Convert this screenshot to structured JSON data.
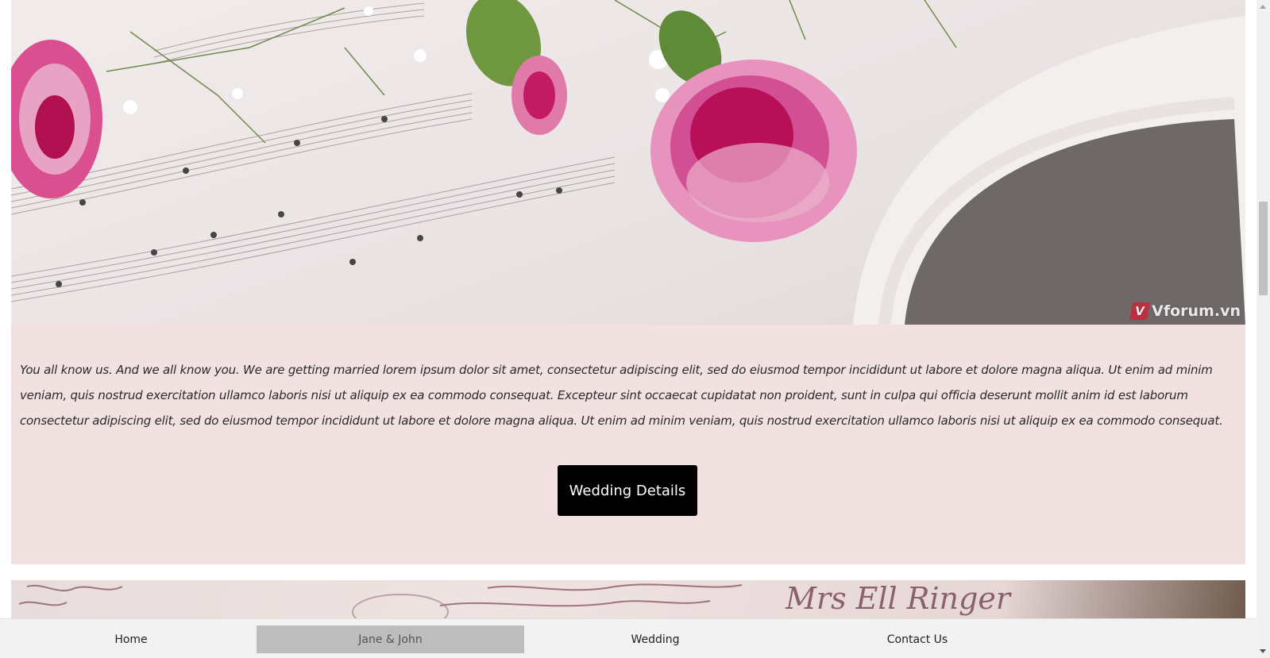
{
  "hero": {
    "image_name": "flowers-on-sheet-music",
    "watermark_logo": "V",
    "watermark_text": "Vforum.vn"
  },
  "intro": {
    "text": "You all know us. And we all know you. We are getting married lorem ipsum dolor sit amet, consectetur adipiscing elit, sed do eiusmod tempor incididunt ut labore et dolore magna aliqua. Ut enim ad minim veniam, quis nostrud exercitation ullamco laboris nisi ut aliquip ex ea commodo consequat. Excepteur sint occaecat cupidatat non proident, sunt in culpa qui officia deserunt mollit anim id est laborum consectetur adipiscing elit, sed do eiusmod tempor incididunt ut labore et dolore magna aliqua. Ut enim ad minim veniam, quis nostrud exercitation ullamco laboris nisi ut aliquip ex ea commodo consequat.",
    "button_label": "Wedding Details",
    "background": "#f1e1e1"
  },
  "letter": {
    "image_name": "handwritten-letter",
    "handwriting": "Mrs Ell Ringer"
  },
  "nav": {
    "items": [
      {
        "label": "Home",
        "active": false
      },
      {
        "label": "Jane & John",
        "active": true
      },
      {
        "label": "Wedding",
        "active": false
      },
      {
        "label": "Contact Us",
        "active": false
      }
    ]
  },
  "colors": {
    "accent_pink": "#c81f73",
    "button_bg": "#000000",
    "nav_active": "#bdbdbd",
    "nav_bg": "#f2f2f2"
  }
}
